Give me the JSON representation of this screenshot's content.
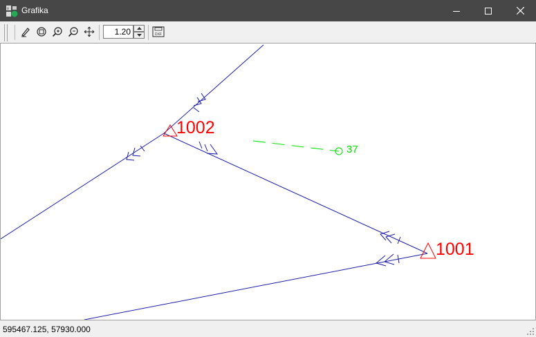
{
  "window": {
    "title": "Grafika",
    "app_icon": "grafika-app-icon",
    "controls": [
      "minimize-icon",
      "maximize-icon",
      "close-icon"
    ]
  },
  "toolbar": {
    "tools": [
      "edit-pen-icon",
      "zoom-extents-icon",
      "zoom-in-icon",
      "zoom-out-icon",
      "pan-icon"
    ],
    "zoom_value": "1.20",
    "export_button": "dxf-export-icon"
  },
  "canvas": {
    "colors": {
      "traverse_lines": "#1a1aa8",
      "control_points": "#ff0000",
      "detail_line": "#00dd00",
      "background": "#ffffff"
    },
    "control_points": [
      {
        "label": "1002"
      },
      {
        "label": "1001"
      }
    ],
    "detail_point": {
      "label": "37"
    }
  },
  "statusbar": {
    "coordinates": "595467.125, 57930.000"
  }
}
